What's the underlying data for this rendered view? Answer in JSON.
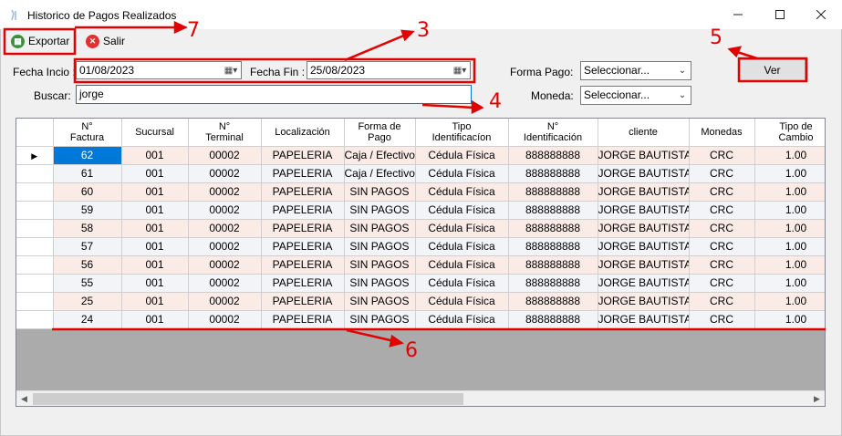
{
  "window": {
    "title": "Historico de Pagos Realizados"
  },
  "toolbar": {
    "export_label": "Exportar",
    "exit_label": "Salir"
  },
  "filters": {
    "fecha_inicio_label": "Fecha Incio :",
    "fecha_inicio_value": "01/08/2023",
    "fecha_fin_label": "Fecha Fin :",
    "fecha_fin_value": "25/08/2023",
    "buscar_label": "Buscar:",
    "buscar_value": "jorge",
    "forma_pago_label": "Forma Pago:",
    "forma_pago_value": "Seleccionar...",
    "moneda_label": "Moneda:",
    "moneda_value": "Seleccionar...",
    "ver_label": "Ver"
  },
  "grid": {
    "columns": [
      {
        "line1": "N°",
        "line2": "Factura"
      },
      {
        "line1": "Sucursal",
        "line2": ""
      },
      {
        "line1": "N°",
        "line2": "Terminal"
      },
      {
        "line1": "Localización",
        "line2": ""
      },
      {
        "line1": "Forma de",
        "line2": "Pago"
      },
      {
        "line1": "Tipo",
        "line2": "Identificacíon"
      },
      {
        "line1": "N°",
        "line2": "Identificación"
      },
      {
        "line1": "cliente",
        "line2": ""
      },
      {
        "line1": "Monedas",
        "line2": ""
      },
      {
        "line1": "Tipo de",
        "line2": "Cambio"
      }
    ],
    "rows": [
      [
        "62",
        "001",
        "00002",
        "PAPELERIA",
        "Caja / Efectivo",
        "Cédula Física",
        "888888888",
        "JORGE BAUTISTA",
        "CRC",
        "1.00"
      ],
      [
        "61",
        "001",
        "00002",
        "PAPELERIA",
        "Caja / Efectivo",
        "Cédula Física",
        "888888888",
        "JORGE BAUTISTA",
        "CRC",
        "1.00"
      ],
      [
        "60",
        "001",
        "00002",
        "PAPELERIA",
        "SIN PAGOS",
        "Cédula Física",
        "888888888",
        "JORGE BAUTISTA",
        "CRC",
        "1.00"
      ],
      [
        "59",
        "001",
        "00002",
        "PAPELERIA",
        "SIN PAGOS",
        "Cédula Física",
        "888888888",
        "JORGE BAUTISTA",
        "CRC",
        "1.00"
      ],
      [
        "58",
        "001",
        "00002",
        "PAPELERIA",
        "SIN PAGOS",
        "Cédula Física",
        "888888888",
        "JORGE BAUTISTA",
        "CRC",
        "1.00"
      ],
      [
        "57",
        "001",
        "00002",
        "PAPELERIA",
        "SIN PAGOS",
        "Cédula Física",
        "888888888",
        "JORGE BAUTISTA",
        "CRC",
        "1.00"
      ],
      [
        "56",
        "001",
        "00002",
        "PAPELERIA",
        "SIN PAGOS",
        "Cédula Física",
        "888888888",
        "JORGE BAUTISTA",
        "CRC",
        "1.00"
      ],
      [
        "55",
        "001",
        "00002",
        "PAPELERIA",
        "SIN PAGOS",
        "Cédula Física",
        "888888888",
        "JORGE BAUTISTA",
        "CRC",
        "1.00"
      ],
      [
        "25",
        "001",
        "00002",
        "PAPELERIA",
        "SIN PAGOS",
        "Cédula Física",
        "888888888",
        "JORGE BAUTISTA",
        "CRC",
        "1.00"
      ],
      [
        "24",
        "001",
        "00002",
        "PAPELERIA",
        "SIN PAGOS",
        "Cédula Física",
        "888888888",
        "JORGE BAUTISTA",
        "CRC",
        "1.00"
      ]
    ]
  },
  "annotations": {
    "n3": "3",
    "n4": "4",
    "n5": "5",
    "n6": "6",
    "n7": "7"
  },
  "icons": {
    "app": "app-icon",
    "export": "export-icon",
    "exit": "close-circle-icon",
    "calendar": "calendar-icon",
    "dropdown": "chevron-down-icon"
  },
  "colors": {
    "accent": "#e00000",
    "selection": "#0078d7",
    "row_odd": "#faebe6",
    "row_even": "#f3f4f8"
  }
}
